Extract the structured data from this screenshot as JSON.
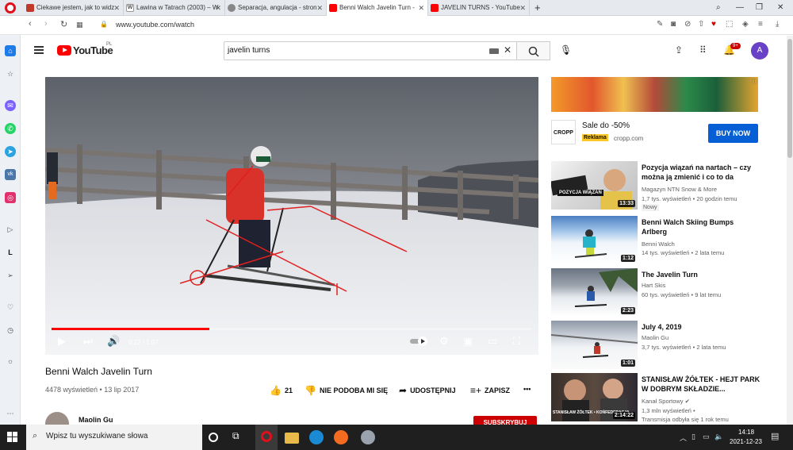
{
  "browser": {
    "tabs": [
      {
        "label": "Ciekawe jestem, jak to widz",
        "favicon_color": "#c0392b"
      },
      {
        "label": "Lawina w Tatrach (2003) – W",
        "favicon_color": "#ffffff"
      },
      {
        "label": "Separacja, angulacja - stron",
        "favicon_color": "#888888"
      },
      {
        "label": "Benni Walch Javelin Turn -",
        "favicon_color": "#ff0000"
      },
      {
        "label": "JAVELIN TURNS - YouTube",
        "favicon_color": "#ff0000"
      }
    ],
    "new_tab": "+",
    "url": "www.youtube.com/watch"
  },
  "youtube": {
    "wordmark": "YouTube",
    "country": "PL",
    "search_query": "javelin turns",
    "notifications_badge": "9+",
    "avatar_letter": "A"
  },
  "player": {
    "current_time": "0:22 / 1:07",
    "progress_fraction": 0.328
  },
  "video": {
    "title": "Benni Walch Javelin Turn",
    "meta": "4478 wyświetleń • 13 lip 2017",
    "likes": "21",
    "dislike_label": "NIE PODOBA MI SIĘ",
    "share_label": "UDOSTĘPNIJ",
    "save_label": "ZAPISZ",
    "more_label": "•••",
    "channel_name": "Maolin Gu",
    "subscribe_label": "SUBSKRYBUJ"
  },
  "ad": {
    "logo_text": "CROPP",
    "title": "Sale do -50%",
    "badge": "Reklama",
    "domain": "cropp.com",
    "button": "BUY NOW"
  },
  "related": [
    {
      "title": "Pozycja wiązań na nartach – czy można ją zmienić i co to da",
      "channel": "Magazyn NTN Snow & More",
      "stats": "1,7 tys. wyświetleń • 20 godzin temu",
      "badge": "Nowy",
      "duration": "13:33",
      "thumb_overlay": "POZYCJA WIĄZAŃ"
    },
    {
      "title": "Benni Walch Skiing Bumps Arlberg",
      "channel": "Benni Walch",
      "stats": "14 tys. wyświetleń • 2 lata temu",
      "duration": "1:12"
    },
    {
      "title": "The Javelin Turn",
      "channel": "Hart Skis",
      "stats": "60 tys. wyświetleń • 9 lat temu",
      "duration": "2:23"
    },
    {
      "title": "July 4, 2019",
      "channel": "Maolin Gu",
      "stats": "3,7 tys. wyświetleń • 2 lata temu",
      "duration": "1:01"
    },
    {
      "title": "STANISŁAW ŻÓŁTEK - HEJT PARK W DOBRYM SKŁADZIE...",
      "channel": "Kanał Sportowy ✔",
      "stats": "1,3 mln wyświetleń • ",
      "stats2": "Transmisja odbyła się 1 rok temu",
      "duration": "2:14:22",
      "thumb_overlay": "STANISŁAW ŻÓŁTEK • KOŃFEDERACJA"
    }
  ],
  "taskbar": {
    "search_placeholder": "Wpisz tu wyszukiwane słowa",
    "time": "14:18",
    "date": "2021-12-23"
  },
  "colors": {
    "yt_red": "#ff0000",
    "ad_blue": "#065fd4",
    "opera_red": "#e0101a"
  }
}
